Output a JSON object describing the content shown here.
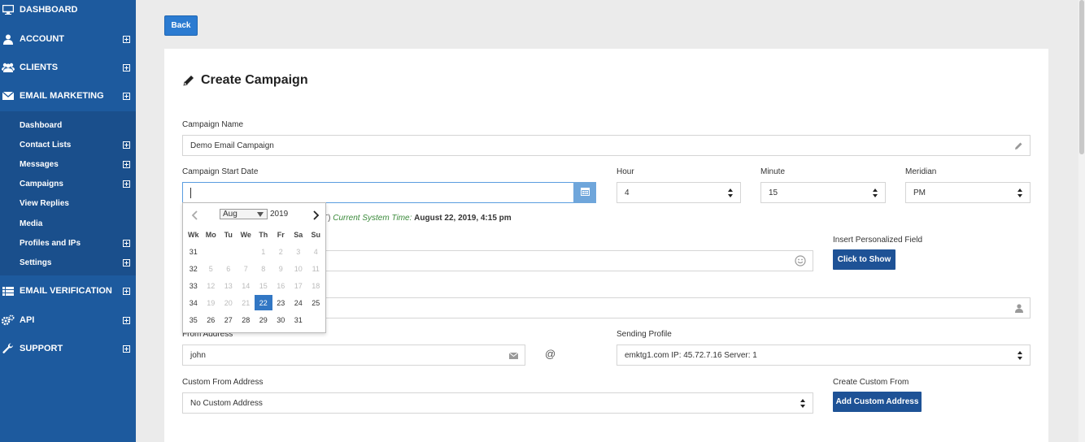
{
  "sidebar": {
    "items": [
      {
        "label": "DASHBOARD",
        "icon": "monitor-icon"
      },
      {
        "label": "ACCOUNT",
        "icon": "user-icon"
      },
      {
        "label": "CLIENTS",
        "icon": "users-icon"
      },
      {
        "label": "EMAIL MARKETING",
        "icon": "envelope-icon"
      },
      {
        "label": "EMAIL VERIFICATION",
        "icon": "list-icon"
      },
      {
        "label": "API",
        "icon": "gears-icon"
      },
      {
        "label": "SUPPORT",
        "icon": "wrench-icon"
      }
    ],
    "submenu": [
      {
        "label": "Dashboard"
      },
      {
        "label": "Contact Lists"
      },
      {
        "label": "Messages"
      },
      {
        "label": "Campaigns"
      },
      {
        "label": "View Replies"
      },
      {
        "label": "Media"
      },
      {
        "label": "Profiles and IPs"
      },
      {
        "label": "Settings"
      }
    ]
  },
  "back_label": "Back",
  "form": {
    "title": "Create Campaign",
    "campaign_name_label": "Campaign Name",
    "campaign_name_value": "Demo Email Campaign",
    "start_date_label": "Campaign Start Date",
    "hour_label": "Hour",
    "hour_value": "4",
    "minute_label": "Minute",
    "minute_value": "15",
    "meridian_label": "Meridian",
    "meridian_value": "PM",
    "tz_tail": "T)",
    "system_time_label": "Current System Time:",
    "system_time_value": "August 22, 2019, 4:15 pm",
    "personalized_label": "Insert Personalized Field",
    "click_to_show": "Click to Show",
    "from_address_label": "From Address",
    "from_address_value": "john",
    "at_sign": "@",
    "sending_profile_label": "Sending Profile",
    "sending_profile_value": "emktg1.com IP: 45.72.7.16 Server: 1",
    "custom_from_label": "Custom From Address",
    "custom_from_value": "No Custom Address",
    "create_custom_label": "Create Custom From",
    "add_custom_button": "Add Custom Address"
  },
  "datepicker": {
    "month": "Aug",
    "year": "2019",
    "headers": [
      "Wk",
      "Mo",
      "Tu",
      "We",
      "Th",
      "Fr",
      "Sa",
      "Su"
    ],
    "weeks": [
      [
        "31",
        "",
        "",
        "",
        "1",
        "2",
        "3",
        "4"
      ],
      [
        "32",
        "5",
        "6",
        "7",
        "8",
        "9",
        "10",
        "11"
      ],
      [
        "33",
        "12",
        "13",
        "14",
        "15",
        "16",
        "17",
        "18"
      ],
      [
        "34",
        "19",
        "20",
        "21",
        "22",
        "23",
        "24",
        "25"
      ],
      [
        "35",
        "26",
        "27",
        "28",
        "29",
        "30",
        "31",
        ""
      ]
    ],
    "selected": "22"
  }
}
